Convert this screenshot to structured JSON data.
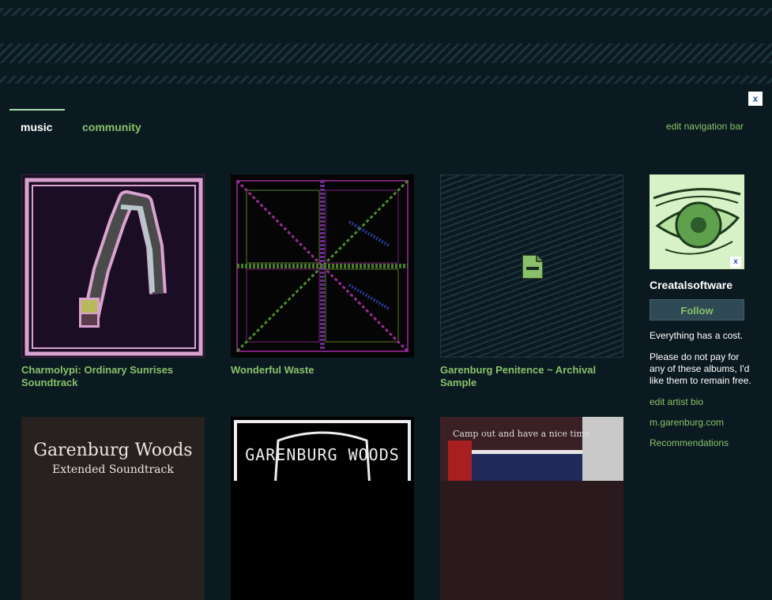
{
  "nav": {
    "tabs": [
      "music",
      "community"
    ],
    "edit_label": "edit navigation bar",
    "close_label": "x"
  },
  "albums": [
    {
      "title": "Charmolypi: Ordinary Sunrises Soundtrack"
    },
    {
      "title": "Wonderful Waste"
    },
    {
      "title": "Garenburg Penitence ~ Archival Sample"
    },
    {
      "title": "",
      "cover_text_1": "Garenburg Woods",
      "cover_text_2": "Extended Soundtrack"
    },
    {
      "title": "",
      "cover_text": "GARENBURG WOODS"
    },
    {
      "title": "",
      "cover_text": "Camp out and have a nice time"
    }
  ],
  "sidebar": {
    "artist_name": "Creatalsoftware",
    "follow_label": "Follow",
    "bio_line1": "Everything has a cost.",
    "bio_line2": "Please do not pay for any of these albums, I'd like them to remain free.",
    "edit_bio": "edit artist bio",
    "site_link": "m.garenburg.com",
    "recommendations": "Recommendations",
    "close_label": "x"
  },
  "colors": {
    "background": "#0b1a20",
    "link_green": "#88c06b",
    "text_white": "#ffffff"
  },
  "icons": [
    "close-icon",
    "file-icon"
  ]
}
